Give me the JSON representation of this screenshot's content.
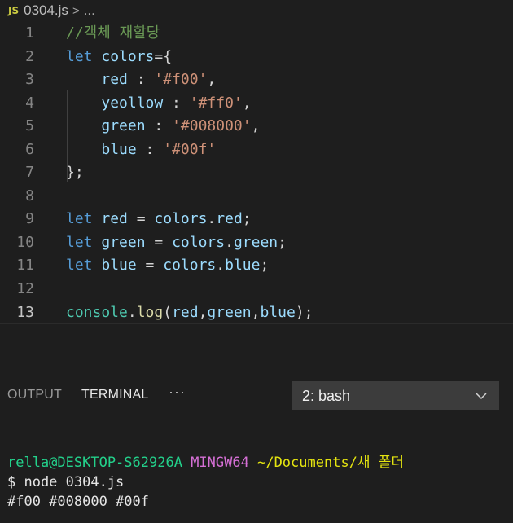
{
  "breadcrumb": {
    "file_badge": "JS",
    "file_name": "0304.js",
    "separator": ">",
    "more": "..."
  },
  "editor": {
    "line_numbers": [
      "1",
      "2",
      "3",
      "4",
      "5",
      "6",
      "7",
      "8",
      "9",
      "10",
      "11",
      "12",
      "13"
    ],
    "current_line": 13,
    "lines": [
      [
        {
          "t": "//객체 재할당",
          "c": "comment"
        }
      ],
      [
        {
          "t": "let",
          "c": "keyword"
        },
        {
          "t": " ",
          "c": "punc"
        },
        {
          "t": "colors",
          "c": "var"
        },
        {
          "t": "={",
          "c": "punc"
        }
      ],
      [
        {
          "t": "    ",
          "c": "punc"
        },
        {
          "t": "red",
          "c": "var"
        },
        {
          "t": " : ",
          "c": "punc"
        },
        {
          "t": "'#f00'",
          "c": "string"
        },
        {
          "t": ",",
          "c": "punc"
        }
      ],
      [
        {
          "t": "    ",
          "c": "punc"
        },
        {
          "t": "yeollow",
          "c": "var"
        },
        {
          "t": " : ",
          "c": "punc"
        },
        {
          "t": "'#ff0'",
          "c": "string"
        },
        {
          "t": ",",
          "c": "punc"
        }
      ],
      [
        {
          "t": "    ",
          "c": "punc"
        },
        {
          "t": "green",
          "c": "var"
        },
        {
          "t": " : ",
          "c": "punc"
        },
        {
          "t": "'#008000'",
          "c": "string"
        },
        {
          "t": ",",
          "c": "punc"
        }
      ],
      [
        {
          "t": "    ",
          "c": "punc"
        },
        {
          "t": "blue",
          "c": "var"
        },
        {
          "t": " : ",
          "c": "punc"
        },
        {
          "t": "'#00f'",
          "c": "string"
        }
      ],
      [
        {
          "t": "};",
          "c": "punc"
        }
      ],
      [],
      [
        {
          "t": "let",
          "c": "keyword"
        },
        {
          "t": " ",
          "c": "punc"
        },
        {
          "t": "red",
          "c": "var"
        },
        {
          "t": " = ",
          "c": "punc"
        },
        {
          "t": "colors",
          "c": "var"
        },
        {
          "t": ".",
          "c": "punc"
        },
        {
          "t": "red",
          "c": "var"
        },
        {
          "t": ";",
          "c": "punc"
        }
      ],
      [
        {
          "t": "let",
          "c": "keyword"
        },
        {
          "t": " ",
          "c": "punc"
        },
        {
          "t": "green",
          "c": "var"
        },
        {
          "t": " = ",
          "c": "punc"
        },
        {
          "t": "colors",
          "c": "var"
        },
        {
          "t": ".",
          "c": "punc"
        },
        {
          "t": "green",
          "c": "var"
        },
        {
          "t": ";",
          "c": "punc"
        }
      ],
      [
        {
          "t": "let",
          "c": "keyword"
        },
        {
          "t": " ",
          "c": "punc"
        },
        {
          "t": "blue",
          "c": "var"
        },
        {
          "t": " = ",
          "c": "punc"
        },
        {
          "t": "colors",
          "c": "var"
        },
        {
          "t": ".",
          "c": "punc"
        },
        {
          "t": "blue",
          "c": "var"
        },
        {
          "t": ";",
          "c": "punc"
        }
      ],
      [],
      [
        {
          "t": "console",
          "c": "console"
        },
        {
          "t": ".",
          "c": "punc"
        },
        {
          "t": "log",
          "c": "func"
        },
        {
          "t": "(",
          "c": "punc"
        },
        {
          "t": "red",
          "c": "var"
        },
        {
          "t": ",",
          "c": "punc"
        },
        {
          "t": "green",
          "c": "var"
        },
        {
          "t": ",",
          "c": "punc"
        },
        {
          "t": "blue",
          "c": "var"
        },
        {
          "t": ");",
          "c": "punc"
        }
      ]
    ]
  },
  "panel": {
    "tabs": {
      "output": "OUTPUT",
      "terminal": "TERMINAL",
      "more": "···"
    },
    "terminal_select": "2: bash"
  },
  "terminal": {
    "prompt_user_host": "rella@DESKTOP-S62926A",
    "prompt_env": "MINGW64",
    "prompt_path": "~/Documents/새 폴더",
    "command": "$ node 0304.js",
    "output": "#f00 #008000 #00f"
  },
  "colors": {
    "background": "#1e1e1e",
    "keyword": "#569cd6",
    "variable": "#9cdcfe",
    "string": "#ce9178",
    "comment": "#6a9955",
    "function": "#dcdcaa",
    "class": "#4ec9b0",
    "terminal_green": "#23d18b",
    "terminal_magenta": "#d670d6",
    "terminal_yellow": "#e5e510"
  }
}
